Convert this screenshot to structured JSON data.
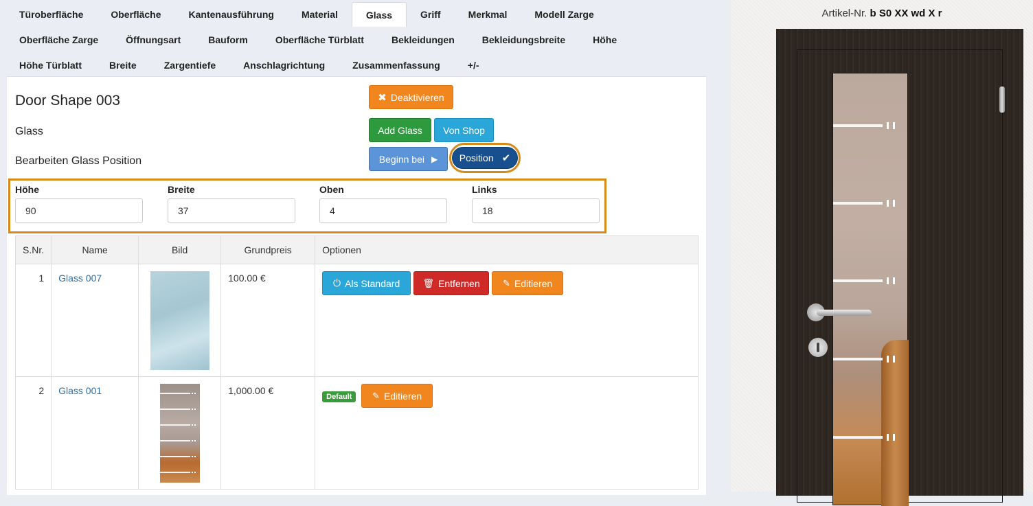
{
  "tabs_row1": [
    "Türoberfläche",
    "Oberfläche",
    "Kantenausführung",
    "Material",
    "Glass",
    "Griff",
    "Merkmal",
    "Modell Zarge"
  ],
  "tabs_row2": [
    "Oberfläche Zarge",
    "Öffnungsart",
    "Bauform",
    "Oberfläche Türblatt",
    "Bekleidungen",
    "Bekleidungsbreite",
    "Höhe"
  ],
  "tabs_row3": [
    "Höhe Türblatt",
    "Breite",
    "Zargentiefe",
    "Anschlagrichtung",
    "Zusammenfassung",
    "+/-"
  ],
  "active_tab": "Glass",
  "main": {
    "title": "Door Shape 003",
    "subtitle": "Glass",
    "section": "Bearbeiten Glass Position",
    "buttons": {
      "deactivate": "Deaktivieren",
      "add_glass": "Add Glass",
      "von_shop": "Von Shop",
      "begin_bei": "Beginn bei",
      "position": "Position"
    },
    "fields": {
      "hoehe_label": "Höhe",
      "hoehe_value": "90",
      "breite_label": "Breite",
      "breite_value": "37",
      "oben_label": "Oben",
      "oben_value": "4",
      "links_label": "Links",
      "links_value": "18"
    },
    "table": {
      "headers": [
        "S.Nr.",
        "Name",
        "Bild",
        "Grundpreis",
        "Optionen"
      ],
      "rows": [
        {
          "snr": "1",
          "name": "Glass 007",
          "preis": "100.00 €",
          "als_standard": "Als Standard",
          "entfernen": "Entfernen",
          "editieren": "Editieren"
        },
        {
          "snr": "2",
          "name": "Glass 001",
          "preis": "1,000.00 €",
          "badge": "Default",
          "editieren": "Editieren"
        }
      ]
    }
  },
  "preview": {
    "artikel_label": "Artikel-Nr.",
    "artikel_value": "b S0 XX wd X r"
  },
  "colors": {
    "orange": "#f0861d",
    "green": "#2e9a3e",
    "blue": "#2aa7d8",
    "red": "#cf2a27",
    "dark_blue": "#18508f",
    "highlight": "#d68a18"
  }
}
